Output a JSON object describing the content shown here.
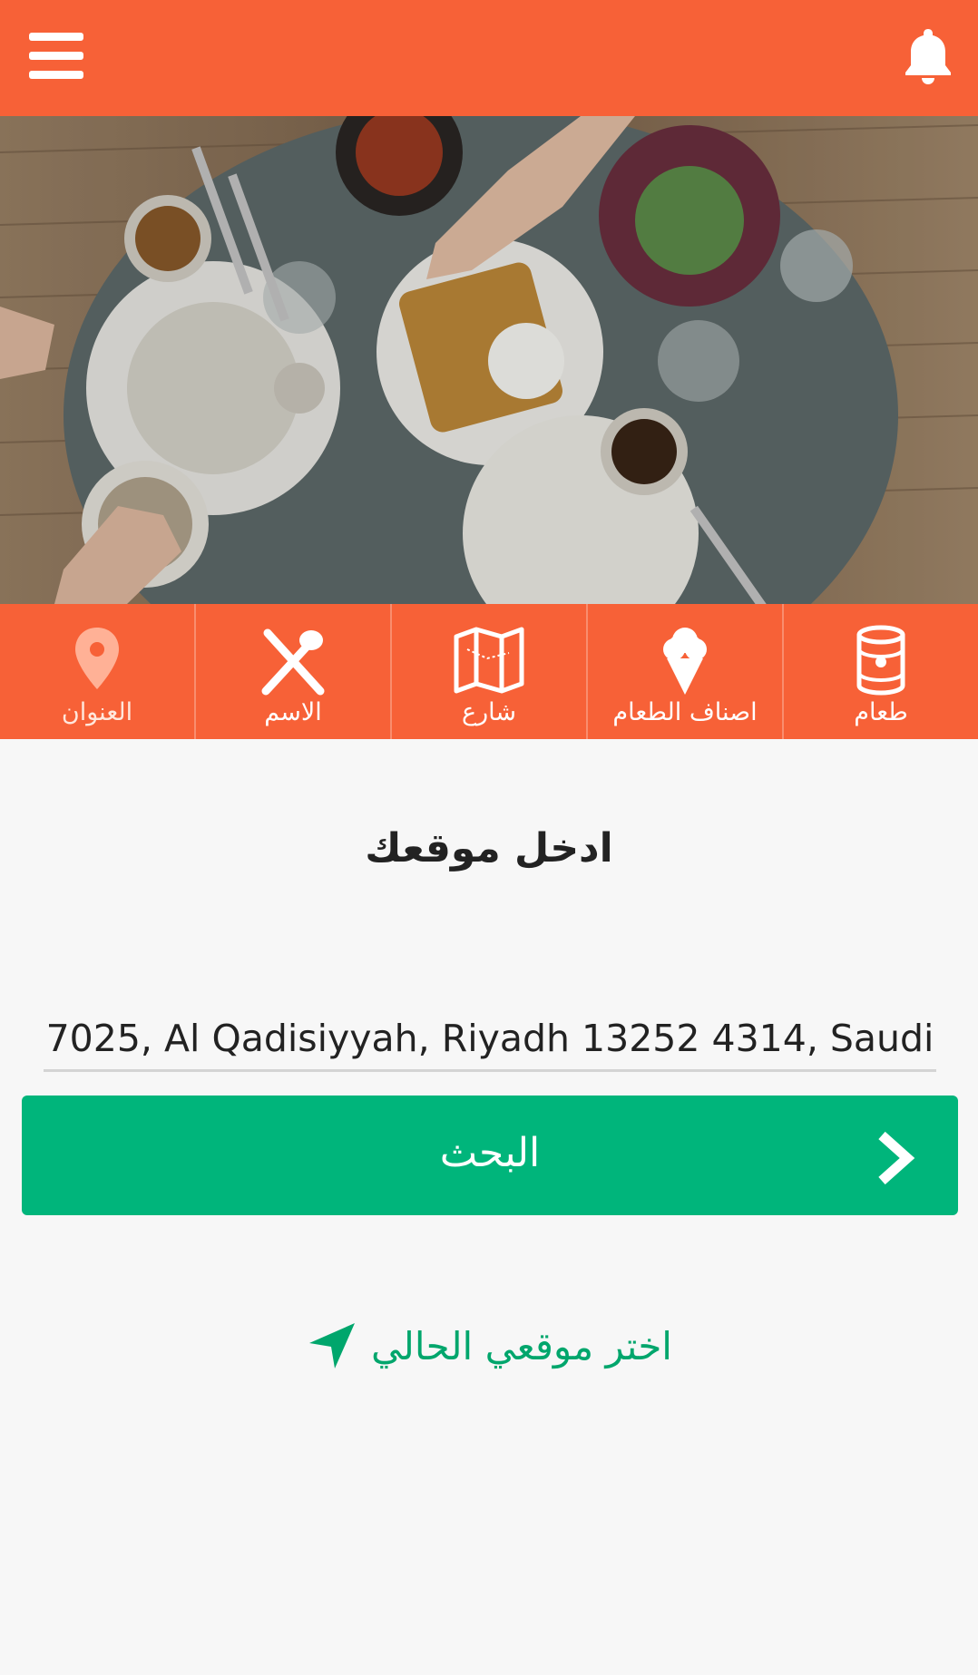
{
  "header": {
    "menu_icon": "hamburger-menu-icon",
    "notification_icon": "bell-icon"
  },
  "hero": {
    "image": "restaurant table with breakfast dishes"
  },
  "categories": [
    {
      "label": "العنوان",
      "icon": "location-pin-icon"
    },
    {
      "label": "الاسم",
      "icon": "fork-spoon-icon"
    },
    {
      "label": "شارع",
      "icon": "map-icon"
    },
    {
      "label": "اصناف الطعام",
      "icon": "ice-cream-icon"
    },
    {
      "label": "طعام",
      "icon": "can-icon"
    }
  ],
  "main": {
    "title": "ادخل موقعك",
    "address_value": "7025, Al Qadisiyyah, Riyadh 13252 4314, Saudi",
    "search_label": "البحث",
    "current_location_label": "اختر موقعي الحالي"
  },
  "colors": {
    "primary": "#f76137",
    "accent": "#00b57b",
    "link": "#00a66c"
  }
}
